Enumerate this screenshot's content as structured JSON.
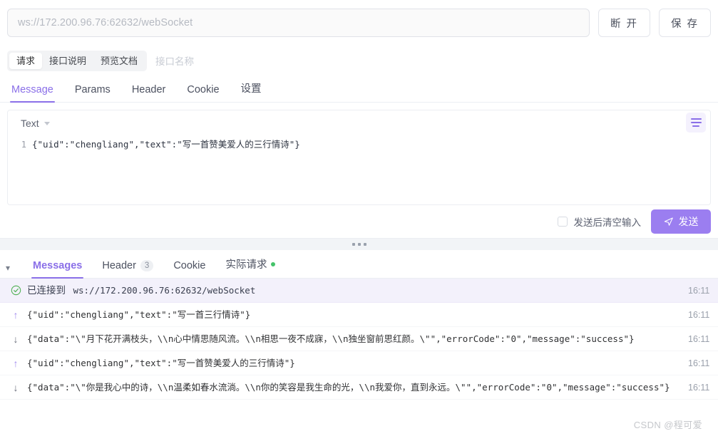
{
  "urlbar": {
    "url_placeholder": "ws://172.200.96.76:62632/webSocket",
    "disconnect_label": "断 开",
    "save_label": "保 存"
  },
  "doc_tabs": {
    "items": [
      {
        "label": "请求"
      },
      {
        "label": "接口说明"
      },
      {
        "label": "预览文档"
      }
    ],
    "active_index": 0,
    "interface_name_placeholder": "接口名称"
  },
  "main_tabs": {
    "items": [
      {
        "label": "Message"
      },
      {
        "label": "Params"
      },
      {
        "label": "Header"
      },
      {
        "label": "Cookie"
      },
      {
        "label": "设置"
      }
    ],
    "active_index": 0
  },
  "editor": {
    "type_label": "Text",
    "format_icon": "format-lines-icon",
    "line_number": "1",
    "content": "{\"uid\":\"chengliang\",\"text\":\"写一首赞美爱人的三行情诗\"}"
  },
  "send_row": {
    "clear_after_send_label": "发送后清空输入",
    "clear_after_send_checked": false,
    "send_label": "发送",
    "send_icon": "paper-plane-icon",
    "send_color": "#9b7ef0"
  },
  "result_tabs": {
    "collapse_icon": "chevron-down-icon",
    "items": [
      {
        "label": "Messages",
        "badge": "",
        "dot": false
      },
      {
        "label": "Header",
        "badge": "3",
        "dot": false
      },
      {
        "label": "Cookie",
        "badge": "",
        "dot": false
      },
      {
        "label": "实际请求",
        "badge": "",
        "dot": true
      }
    ],
    "active_index": 0,
    "dot_color": "#45c36a"
  },
  "messages": [
    {
      "kind": "system",
      "icon": "check-circle-icon",
      "label": "已连接到",
      "text": "ws://172.200.96.76:62632/webSocket",
      "time": "16:11"
    },
    {
      "kind": "sent",
      "icon": "arrow-up-icon",
      "text": "{\"uid\":\"chengliang\",\"text\":\"写一首三行情诗\"}",
      "time": "16:11"
    },
    {
      "kind": "received",
      "icon": "arrow-down-icon",
      "text": "{\"data\":\"\\\"月下花开满枝头，\\\\n心中情思随风流。\\\\n相思一夜不成寐，\\\\n独坐窗前思红颜。\\\"\",\"errorCode\":\"0\",\"message\":\"success\"}",
      "time": "16:11"
    },
    {
      "kind": "sent",
      "icon": "arrow-up-icon",
      "text": "{\"uid\":\"chengliang\",\"text\":\"写一首赞美爱人的三行情诗\"}",
      "time": "16:11"
    },
    {
      "kind": "received",
      "icon": "arrow-down-icon",
      "text": "{\"data\":\"\\\"你是我心中的诗，\\\\n温柔如春水流淌。\\\\n你的笑容是我生命的光，\\\\n我爱你，直到永远。\\\"\",\"errorCode\":\"0\",\"message\":\"success\"}",
      "time": "16:11"
    }
  ],
  "watermark": {
    "text": "CSDN @程可爱"
  }
}
